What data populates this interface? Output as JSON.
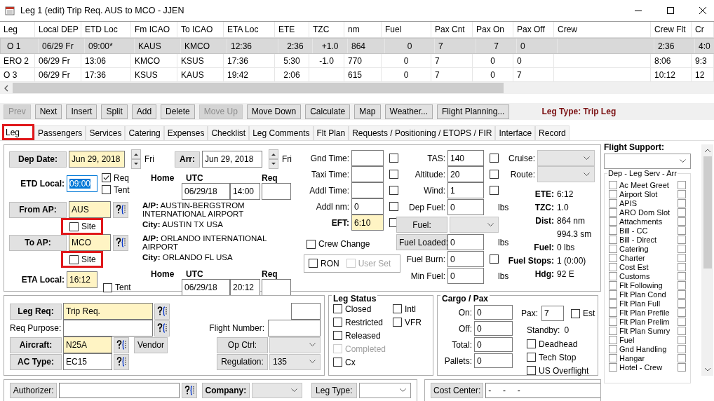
{
  "window": {
    "title": "Leg 1 (edit) Trip Req. AUS to MCO - JJEN"
  },
  "table": {
    "columns": [
      "Leg",
      "Local DEP",
      "ETD Loc",
      "Fm ICAO",
      "To ICAO",
      "ETA Loc",
      "ETE",
      "TZC",
      "nm",
      "Fuel",
      "Pax Cnt",
      "Pax On",
      "Pax Off",
      "Crew",
      "Crew Flt",
      "Cr"
    ],
    "rows": [
      {
        "selected": true,
        "cells": [
          "O 1",
          "06/29 Fr",
          "09:00*",
          "KAUS",
          "KMCO",
          "12:36",
          "2:36",
          "+1.0",
          "864",
          "0",
          "7",
          "7",
          "0",
          null,
          "2:36",
          "4:0"
        ]
      },
      {
        "selected": false,
        "cells": [
          "ERO 2",
          "06/29 Fr",
          "13:06",
          "KMCO",
          "KSUS",
          "17:36",
          "5:30",
          "-1.0",
          "770",
          "0",
          "7",
          "0",
          "0",
          null,
          "8:06",
          "9:3"
        ]
      },
      {
        "selected": false,
        "cells": [
          "O 3",
          "06/29 Fr",
          "17:36",
          "KSUS",
          "KAUS",
          "19:42",
          "2:06",
          null,
          "615",
          "0",
          "7",
          "0",
          "7",
          null,
          "10:12",
          "12"
        ]
      }
    ]
  },
  "toolbar": {
    "buttons": [
      {
        "label": "Prev",
        "disabled": true
      },
      {
        "label": "Next",
        "disabled": false
      },
      {
        "label": "Insert",
        "disabled": false
      },
      {
        "label": "Split",
        "disabled": false
      },
      {
        "label": "Add",
        "disabled": false
      },
      {
        "label": "Delete",
        "disabled": false
      },
      {
        "label": "Move Up",
        "disabled": true
      },
      {
        "label": "Move Down",
        "disabled": false
      },
      {
        "label": "Calculate",
        "disabled": false
      },
      {
        "label": "Map",
        "disabled": false
      },
      {
        "label": "Weather...",
        "disabled": false
      },
      {
        "label": "Flight Planning...",
        "disabled": false
      }
    ],
    "leg_type": "Leg Type:  Trip Leg"
  },
  "tabs": [
    {
      "label": "Leg",
      "selected": true,
      "highlighted": true
    },
    {
      "label": "Passengers",
      "selected": false,
      "highlighted": false
    },
    {
      "label": "Services",
      "selected": false,
      "highlighted": false
    },
    {
      "label": "Catering",
      "selected": false,
      "highlighted": false
    },
    {
      "label": "Expenses",
      "selected": false,
      "highlighted": false
    },
    {
      "label": "Checklist",
      "selected": false,
      "highlighted": false
    },
    {
      "label": "Leg Comments",
      "selected": false,
      "highlighted": false
    },
    {
      "label": "Flt Plan",
      "selected": false,
      "highlighted": false
    },
    {
      "label": "Requests / Positioning / ETOPS / FIR",
      "selected": false,
      "highlighted": false
    },
    {
      "label": "Interface",
      "selected": false,
      "highlighted": false
    },
    {
      "label": "Record",
      "selected": false,
      "highlighted": false
    }
  ],
  "leg": {
    "dep_date": {
      "label": "Dep Date:",
      "value": "Jun 29, 2018",
      "day": "Fri",
      "required": true
    },
    "arr_date": {
      "label": "Arr:",
      "value": "Jun 29, 2018",
      "day": "Fri",
      "required": false
    },
    "etd_local": {
      "label": "ETD Local:",
      "value": "09:00",
      "selected": true
    },
    "etd_flags": [
      {
        "label": "Req",
        "checked": true
      },
      {
        "label": "Tent",
        "checked": false
      }
    ],
    "dep_utc": {
      "headers": [
        "Home",
        "UTC",
        "Req"
      ],
      "date": "06/29/18",
      "time": "14:00"
    },
    "from_ap": {
      "label": "From AP:",
      "value": "AUS",
      "required": true,
      "site": {
        "label": "Site",
        "checked": false,
        "highlighted": true
      }
    },
    "from_info": [
      {
        "label": "A/P:",
        "value": "AUSTIN-BERGSTROM INTERNATIONAL AIRPORT"
      },
      {
        "label": "City:",
        "value": "AUSTIN TX USA"
      }
    ],
    "to_ap": {
      "label": "To AP:",
      "value": "MCO",
      "required": true,
      "site": {
        "label": "Site",
        "checked": false,
        "highlighted": true
      }
    },
    "to_info": [
      {
        "label": "A/P:",
        "value": "ORLANDO INTERNATIONAL AIRPORT"
      },
      {
        "label": "City:",
        "value": "ORLANDO FL USA"
      }
    ],
    "eta_local": {
      "label": "ETA Local:",
      "value": "16:12",
      "required": true,
      "tent": {
        "label": "Tent",
        "checked": false
      }
    },
    "arr_utc": {
      "headers": [
        "Home",
        "UTC",
        "Req"
      ],
      "date": "06/29/18",
      "time": "20:12"
    },
    "times": [
      {
        "label": "Gnd Time:",
        "checked": false,
        "required": false
      },
      {
        "label": "Taxi Time:",
        "checked": false,
        "required": false
      },
      {
        "label": "Addl Time:",
        "checked": false,
        "required": false
      },
      {
        "label": "Addl nm:",
        "value": "0",
        "checked": false,
        "required": false
      },
      {
        "label": "EFT:",
        "value": "6:10",
        "checked": false,
        "required": true
      }
    ],
    "crew_change": {
      "label": "Crew Change",
      "checked": false
    },
    "ron": {
      "label": "RON",
      "checked": false
    },
    "user_set": {
      "label": "User Set",
      "checked": false,
      "disabled": true
    },
    "perf": [
      {
        "kind": "check",
        "label": "TAS:",
        "value": "140",
        "checked": false
      },
      {
        "kind": "check",
        "label": "Altitude:",
        "value": "20",
        "checked": false
      },
      {
        "kind": "check",
        "label": "Wind:",
        "value": "1",
        "checked": false
      },
      {
        "kind": "unit",
        "label": "Dep Fuel:",
        "value": "0",
        "unit": "lbs"
      },
      {
        "kind": "select",
        "label": "Fuel:"
      },
      {
        "kind": "button-unit",
        "label": "Fuel Loaded:",
        "value": "0",
        "unit": "lbs"
      },
      {
        "kind": "check",
        "label": "Fuel Burn:",
        "value": "0",
        "checked": false
      },
      {
        "kind": "unit",
        "label": "Min Fuel:",
        "value": "0",
        "unit": "lbs"
      }
    ],
    "selects": [
      {
        "label": "Cruise:"
      },
      {
        "label": "Route:"
      }
    ],
    "summary": [
      {
        "label": "ETE:",
        "value": "6:12"
      },
      {
        "label": "TZC:",
        "value": "1.0"
      },
      {
        "label": "Dist:",
        "value": "864 nm"
      },
      {
        "value": "994.3 sm"
      },
      {
        "label": "Fuel:",
        "value": "0  lbs"
      },
      {
        "label": "Fuel Stops:",
        "value": "1 (0:00)"
      },
      {
        "label": "Hdg:",
        "value": "92 E"
      }
    ]
  },
  "request": {
    "leg_req": {
      "label": "Leg Req:",
      "value": "Trip Req.",
      "required": true
    },
    "req_purpose": {
      "label": "Req Purpose:"
    },
    "flight_number": {
      "label": "Flight Number:"
    },
    "aircraft": {
      "label": "Aircraft:",
      "value": "N25A",
      "required": true
    },
    "vendor": "Vendor",
    "ac_type": {
      "label": "AC Type:",
      "value": "EC15",
      "required": false
    },
    "op_ctrl": {
      "label": "Op Ctrl:"
    },
    "regulation": {
      "label": "Regulation:",
      "value": "135"
    }
  },
  "leg_status": {
    "title": "Leg Status",
    "columns": [
      [
        {
          "label": "Closed",
          "checked": false,
          "disabled": false
        },
        {
          "label": "Restricted",
          "checked": false,
          "disabled": false
        },
        {
          "label": "Released",
          "checked": false,
          "disabled": false
        },
        {
          "label": "Completed",
          "checked": false,
          "disabled": true
        },
        {
          "label": "Cx",
          "checked": false,
          "disabled": false
        }
      ],
      [
        {
          "label": "Intl",
          "checked": false,
          "disabled": false
        },
        {
          "label": "VFR",
          "checked": false,
          "disabled": false
        }
      ]
    ]
  },
  "cargo": {
    "title": "Cargo / Pax",
    "counts": [
      {
        "label": "On:",
        "value": "0"
      },
      {
        "label": "Off:",
        "value": "0"
      },
      {
        "label": "Total:",
        "value": "0"
      },
      {
        "label": "Pallets:",
        "value": "0"
      }
    ],
    "pax": {
      "label": "Pax:",
      "value": "7"
    },
    "est": {
      "label": "Est",
      "checked": false
    },
    "standby": {
      "label": "Standby:",
      "value": "0"
    },
    "flags": [
      {
        "label": "Deadhead",
        "checked": false
      },
      {
        "label": "Tech Stop",
        "checked": false
      },
      {
        "label": "US Overflight",
        "checked": false
      }
    ]
  },
  "flight_support": {
    "title": "Flight Support:",
    "group": "Dep - Leg Serv - Arr",
    "services": [
      {
        "label": "Ac Meet Greet",
        "dep": false,
        "arr": false
      },
      {
        "label": "Airport Slot",
        "dep": false,
        "arr": false
      },
      {
        "label": "APIS",
        "dep": false,
        "arr": false
      },
      {
        "label": "ARO Dom Slot",
        "dep": false,
        "arr": false
      },
      {
        "label": "Attachments",
        "dep": false,
        "arr": false
      },
      {
        "label": "Bill - CC",
        "dep": false,
        "arr": false
      },
      {
        "label": "Bill - Direct",
        "dep": false,
        "arr": false
      },
      {
        "label": "Catering",
        "dep": false,
        "arr": false
      },
      {
        "label": "Charter",
        "dep": false,
        "arr": false
      },
      {
        "label": "Cost Est",
        "dep": false,
        "arr": false
      },
      {
        "label": "Customs",
        "dep": false,
        "arr": false
      },
      {
        "label": "Flt Following",
        "dep": false,
        "arr": false
      },
      {
        "label": "Flt Plan Cond",
        "dep": false,
        "arr": false
      },
      {
        "label": "Flt Plan Full",
        "dep": false,
        "arr": false
      },
      {
        "label": "Flt Plan Prefile",
        "dep": false,
        "arr": false
      },
      {
        "label": "Flt Plan Prelim",
        "dep": false,
        "arr": false
      },
      {
        "label": "Flt Plan Sumry",
        "dep": false,
        "arr": false
      },
      {
        "label": "Fuel",
        "dep": false,
        "arr": false
      },
      {
        "label": "Gnd Handling",
        "dep": false,
        "arr": false
      },
      {
        "label": "Hangar",
        "dep": false,
        "arr": false
      },
      {
        "label": "Hotel - Crew",
        "dep": false,
        "arr": false
      }
    ]
  },
  "bottom": {
    "authorizer": {
      "label": "Authorizer:"
    },
    "company": {
      "label": "Company:"
    },
    "leg_type": {
      "label": "Leg Type:"
    },
    "cost_center": {
      "label": "Cost Center:",
      "value": "-     -     -"
    }
  }
}
